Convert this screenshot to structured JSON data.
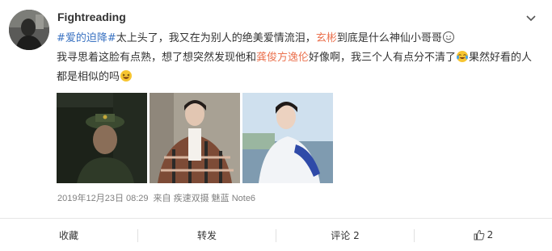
{
  "post": {
    "username": "Fightreading",
    "text": {
      "topic": "#爱的迫降#",
      "part1": "太上头了，我又在为别人的绝美爱情流泪，",
      "mention1": "玄彬",
      "part2": "到底是什么神仙小哥哥",
      "part3": "我寻思着这脸有点熟，想了想突然发现他和",
      "mention2": "龚俊方逸伦",
      "part4": "好像啊，我三个人有点分不清了",
      "part5": "果然好看的人都是相似的吗"
    },
    "meta": {
      "date": "2019年12月23日 08:29",
      "source": "来自 疾速双摄 魅蓝 Note6"
    },
    "images": [
      {
        "desc": "military-uniform-photo"
      },
      {
        "desc": "plaid-coat-photo"
      },
      {
        "desc": "white-hoodie-photo"
      }
    ]
  },
  "actions": {
    "favorite": "收藏",
    "repost": "转发",
    "comment": "评论 2",
    "like_count": "2"
  },
  "icons": {
    "menu": "chevron-down-icon",
    "like": "thumbs-up-icon",
    "emoji_smile": "smile-emoji-icon",
    "emoji_cry": "crying-laugh-emoji-icon",
    "emoji_laugh": "laugh-emoji-icon"
  },
  "colors": {
    "mention": "#eb7350",
    "topic": "#3b73c2",
    "meta": "#808080"
  }
}
